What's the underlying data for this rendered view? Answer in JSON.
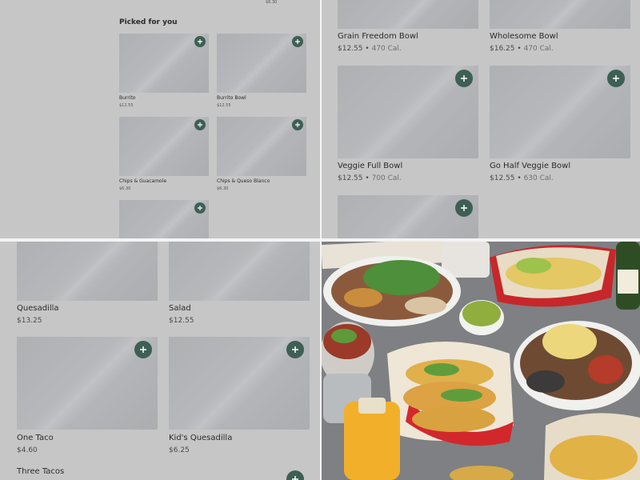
{
  "q1": {
    "top_price": "$6.30",
    "section_title": "Picked for you",
    "items": [
      {
        "name": "Burrito",
        "price": "$12.55"
      },
      {
        "name": "Burrito Bowl",
        "price": "$12.55"
      },
      {
        "name": "Chips & Guacamole",
        "price": "$6.30"
      },
      {
        "name": "Chips & Queso Blanco",
        "price": "$6.30"
      },
      {
        "name": "",
        "price": ""
      }
    ]
  },
  "q2": {
    "items": [
      {
        "name": "Grain Freedom Bowl",
        "price": "$12.55",
        "cal": "470 Cal."
      },
      {
        "name": "Wholesome Bowl",
        "price": "$16.25",
        "cal": "470 Cal."
      },
      {
        "name": "Veggie Full Bowl",
        "price": "$12.55",
        "cal": "700 Cal."
      },
      {
        "name": "Go Half Veggie Bowl",
        "price": "$12.55",
        "cal": "630 Cal."
      }
    ],
    "separator": "•"
  },
  "q3": {
    "items": [
      {
        "name": "Quesadilla",
        "price": "$13.25"
      },
      {
        "name": "Salad",
        "price": "$12.55"
      },
      {
        "name": "One Taco",
        "price": "$4.60"
      },
      {
        "name": "Kid's Quesadilla",
        "price": "$6.25"
      },
      {
        "name": "Three Tacos",
        "price": ""
      }
    ]
  },
  "icons": {
    "add": "plus-icon"
  },
  "colors": {
    "accent": "#3e5f54",
    "placeholder": "#b3b5b8"
  }
}
